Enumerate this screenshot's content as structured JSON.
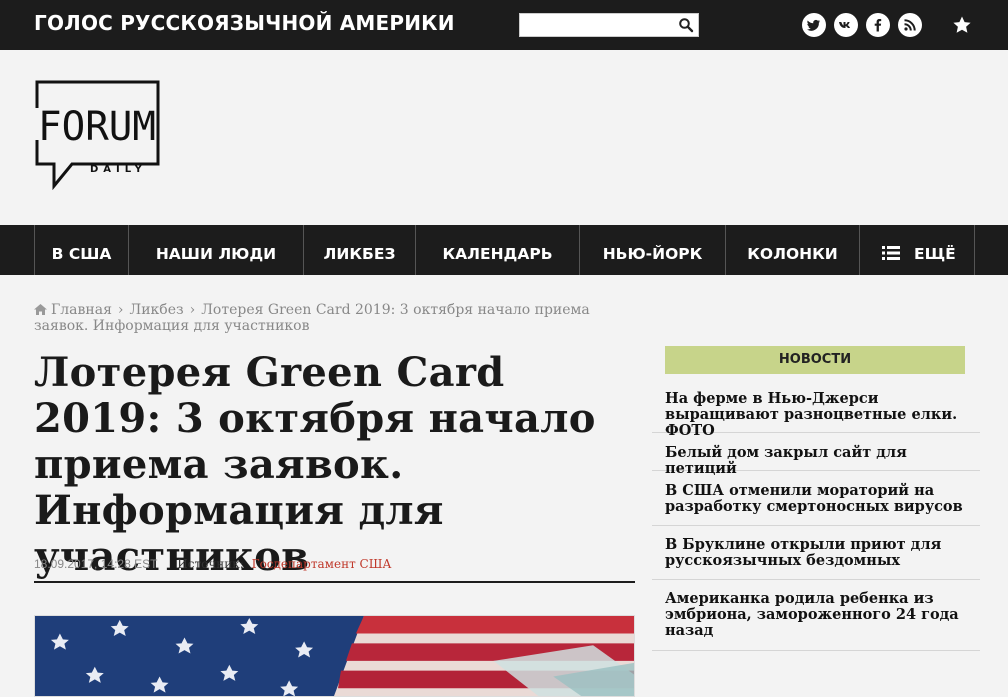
{
  "header": {
    "tagline": "ГОЛОС РУССКОЯЗЫЧНОЙ АМЕРИКИ",
    "search_placeholder": "",
    "social_icons": [
      "twitter-icon",
      "vk-icon",
      "facebook-icon",
      "rss-icon"
    ],
    "bookmark_icon": "star-icon"
  },
  "logo": {
    "word": "FORUM",
    "sub": "DAILY"
  },
  "nav": {
    "items": [
      "В США",
      "НАШИ ЛЮДИ",
      "ЛИКБЕЗ",
      "КАЛЕНДАРЬ",
      "НЬЮ-ЙОРК",
      "КОЛОНКИ",
      "ЕЩЁ"
    ]
  },
  "breadcrumb": {
    "home": "Главная",
    "section": "Ликбез",
    "current": "Лотерея Green Card 2019: 3 октября начало приема заявок. Информация для участников"
  },
  "article": {
    "title": "Лотерея Green Card 2019: 3 октября начало приема заявок. Информация для участников",
    "date": "18.09.2017, 14:28 EST",
    "source_label": "Источник:",
    "source": "Госдепартамент США"
  },
  "sidebar": {
    "heading": "НОВОСТИ",
    "items": [
      "На ферме в Нью-Джерси выращивают разноцветные елки. ФОТО",
      "Белый дом закрыл сайт для петиций",
      "В США отменили мораторий на разработку смертоносных вирусов",
      "В Бруклине открыли приют для русскоязычных бездомных",
      "Американка родила ребенка из эмбриона, замороженного 24 года назад"
    ]
  },
  "colors": {
    "bar": "#1c1c1c",
    "accent": "#c7d48a",
    "source_link": "#c0392b"
  }
}
